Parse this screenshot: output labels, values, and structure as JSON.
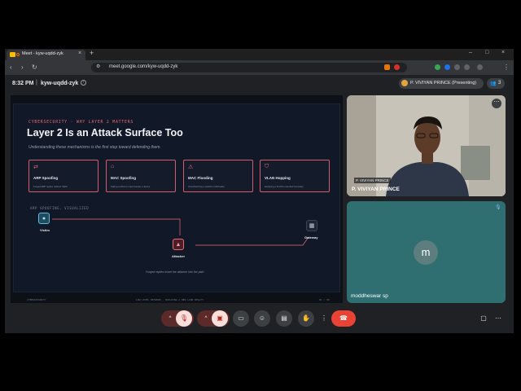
{
  "browser": {
    "tab_title": "Meet - kyw-uqdd-zyk",
    "tab_close": "×",
    "new_tab": "+",
    "url": "meet.google.com/kyw-uqdd-zyk",
    "min": "–",
    "max": "□",
    "close": "×",
    "back": "‹",
    "forward": "›",
    "reload": "↻",
    "menu": "⋮"
  },
  "meeting": {
    "time": "8:32 PM",
    "separator": "|",
    "code": "kyw-uqdd-zyk",
    "info_icon": "i",
    "presenter_label": "P. VIVIYAN PRINCE (Presenting)",
    "participant_count": "3"
  },
  "slide": {
    "eyebrow": "CYBERSECURITY · WHY LAYER 2 MATTERS",
    "title": "Layer 2 Is an Attack Surface Too",
    "subtitle": "Understanding these mechanisms is the first step toward defending them.",
    "cards": [
      {
        "icon": "⇄",
        "title": "ARP Spoofing",
        "desc": "Forged ARP replies redirect traffic."
      },
      {
        "icon": "⌂",
        "title": "MAC Spoofing",
        "desc": "Faking a MAC to impersonate a device."
      },
      {
        "icon": "⚠",
        "title": "MAC Flooding",
        "desc": "Overwhelming a switch's CAM table."
      },
      {
        "icon": "⛉",
        "title": "VLAN Hopping",
        "desc": "Escaping a VLAN's intended boundary."
      }
    ],
    "diagram_heading": "ARP SPOOFING, VISUALIZED",
    "victim_label": "Victim",
    "attacker_label": "Attacker",
    "gateway_label": "Gateway",
    "caption": "Forged replies insert the attacker into the path",
    "footer_left": "CYBERSECURITY",
    "footer_center": "LOW LEVEL NETWORK · BUILDING A NEW LINK REALTY",
    "footer_right": "01 / 08"
  },
  "participants": [
    {
      "name_tag": "P. VIVIYAN PRINCE",
      "name": "P. VIVIYAN PRINCE",
      "more": "⋯"
    },
    {
      "initial": "m",
      "name": "moddheswar sp",
      "mic": "🎙"
    }
  ],
  "controls": {
    "chevron": "^",
    "mic_off": "🎙",
    "cam_off": "▣",
    "present": "▭",
    "emoji": "☺",
    "captions": "▤",
    "hand": "✋",
    "more": "⋮",
    "end": "☎",
    "chat": "▢",
    "activities": "⋯"
  },
  "colors": {
    "accent": "#ef6a75",
    "end_call": "#ea4335",
    "muted_button": "#f9dedc"
  }
}
